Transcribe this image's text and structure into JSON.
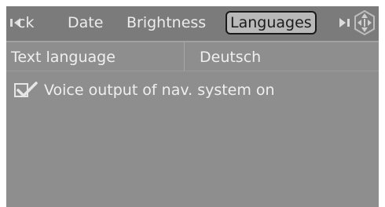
{
  "tabs": {
    "clock_partial": "ck",
    "date": "Date",
    "brightness": "Brightness",
    "languages": "Languages",
    "selected": "Languages"
  },
  "settings": {
    "text_language": {
      "label": "Text language",
      "value": "Deutsch"
    },
    "voice_output": {
      "label": "Voice output of nav. system on",
      "checked": true
    }
  },
  "icons": {
    "scroll_left": "left-arrow-icon",
    "scroll_right": "right-arrow-icon",
    "controller": "controller-knob-icon",
    "checkbox": "checkmark-icon"
  },
  "colors": {
    "background": "#8e8e8e",
    "text": "#efefef",
    "selected_tab_bg": "#b9b9b9"
  }
}
